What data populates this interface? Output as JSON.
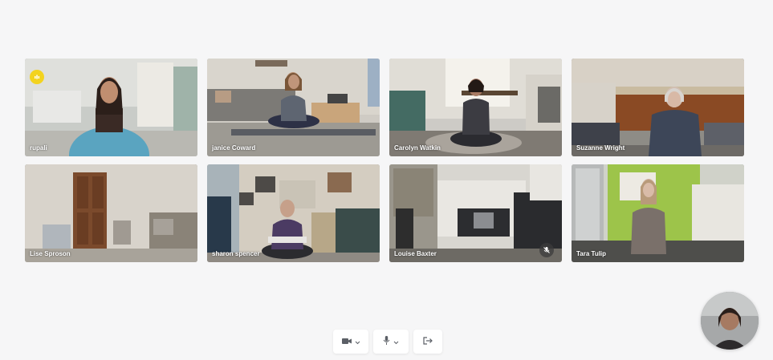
{
  "participants": [
    {
      "name": "rupali",
      "speaking": true,
      "muted": false
    },
    {
      "name": "janice Coward",
      "speaking": false,
      "muted": false
    },
    {
      "name": "Carolyn Watkin",
      "speaking": false,
      "muted": false
    },
    {
      "name": "Suzanne Wright",
      "speaking": false,
      "muted": false
    },
    {
      "name": "Lise Sproson",
      "speaking": false,
      "muted": false
    },
    {
      "name": "sharon spencer",
      "speaking": false,
      "muted": false
    },
    {
      "name": "Louise Baxter",
      "speaking": false,
      "muted": true
    },
    {
      "name": "Tara Tulip",
      "speaking": false,
      "muted": false
    }
  ],
  "controls": {
    "camera_icon": "video-camera-icon",
    "mic_icon": "microphone-icon",
    "leave_icon": "leave-call-icon"
  },
  "colors": {
    "background": "#f6f6f7",
    "speaking_indicator": "#f3d31f"
  }
}
